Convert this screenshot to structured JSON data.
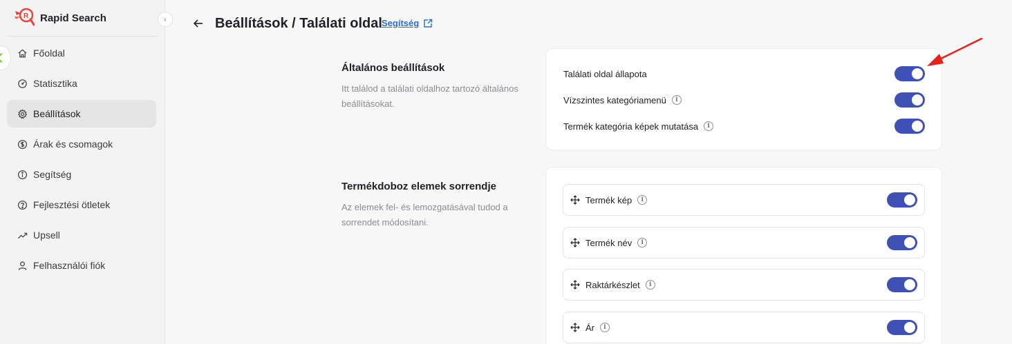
{
  "sidebar": {
    "brand": "Rapid Search",
    "items": [
      {
        "label": "Főoldal",
        "icon": "home-icon"
      },
      {
        "label": "Statisztika",
        "icon": "gauge-icon"
      },
      {
        "label": "Beállítások",
        "icon": "gear-icon",
        "active": true
      },
      {
        "label": "Árak és csomagok",
        "icon": "dollar-icon"
      },
      {
        "label": "Segítség",
        "icon": "info-icon"
      },
      {
        "label": "Fejlesztési ötletek",
        "icon": "question-icon"
      },
      {
        "label": "Upsell",
        "icon": "trend-icon"
      },
      {
        "label": "Felhasználói fiók",
        "icon": "user-icon"
      }
    ]
  },
  "header": {
    "title": "Beállítások / Találati oldal",
    "help_link": "Segítség"
  },
  "general": {
    "title": "Általános beállítások",
    "description": "Itt találod a találati oldalhoz tartozó általános beállításokat.",
    "settings": [
      {
        "label": "Találati oldal állapota",
        "enabled": true,
        "info": false
      },
      {
        "label": "Vízszintes kategóriamenü",
        "enabled": true,
        "info": true
      },
      {
        "label": "Termék kategória képek mutatása",
        "enabled": true,
        "info": true
      }
    ]
  },
  "order": {
    "title": "Termékdoboz elemek sorrendje",
    "description": "Az elemek fel- és lemozgatásával tudod a sorrendet módosítani.",
    "items": [
      {
        "label": "Termék kép",
        "enabled": true
      },
      {
        "label": "Termék név",
        "enabled": true
      },
      {
        "label": "Raktárkészlet",
        "enabled": true
      },
      {
        "label": "Ár",
        "enabled": true
      }
    ]
  },
  "colors": {
    "toggle_on": "#3f51b5",
    "link": "#2c6ecb",
    "annotation_arrow": "#e8211d",
    "brand": "#e8433a"
  }
}
